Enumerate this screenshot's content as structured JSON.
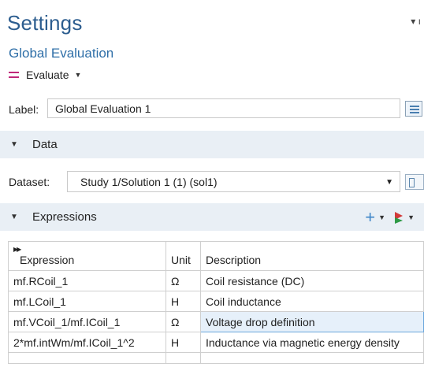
{
  "header": {
    "title": "Settings",
    "subtitle": "Global Evaluation",
    "pin_glyph": "▾ ı"
  },
  "evaluate_button": {
    "label": "Evaluate",
    "icon": "equals-icon",
    "color": "#c0297a"
  },
  "label_field": {
    "label": "Label:",
    "value": "Global Evaluation 1"
  },
  "data_section": {
    "title": "Data",
    "dataset_label": "Dataset:",
    "dataset_value": "Study 1/Solution 1 (1) (sol1)"
  },
  "expressions_section": {
    "title": "Expressions",
    "columns": [
      "Expression",
      "Unit",
      "Description"
    ],
    "rows": [
      {
        "expression": "mf.RCoil_1",
        "unit": "Ω",
        "description": "Coil resistance (DC)"
      },
      {
        "expression": "mf.LCoil_1",
        "unit": "H",
        "description": "Coil inductance"
      },
      {
        "expression": "mf.VCoil_1/mf.ICoil_1",
        "unit": "Ω",
        "description": "Voltage drop definition"
      },
      {
        "expression": "2*mf.intWm/mf.ICoil_1^2",
        "unit": "H",
        "description": "Inductance via magnetic energy density"
      }
    ]
  },
  "colors": {
    "title": "#2c5d8f",
    "section_bg": "#e9eff5",
    "add_icon": "#3f86c8",
    "selected_cell": "#e6f0fa"
  }
}
